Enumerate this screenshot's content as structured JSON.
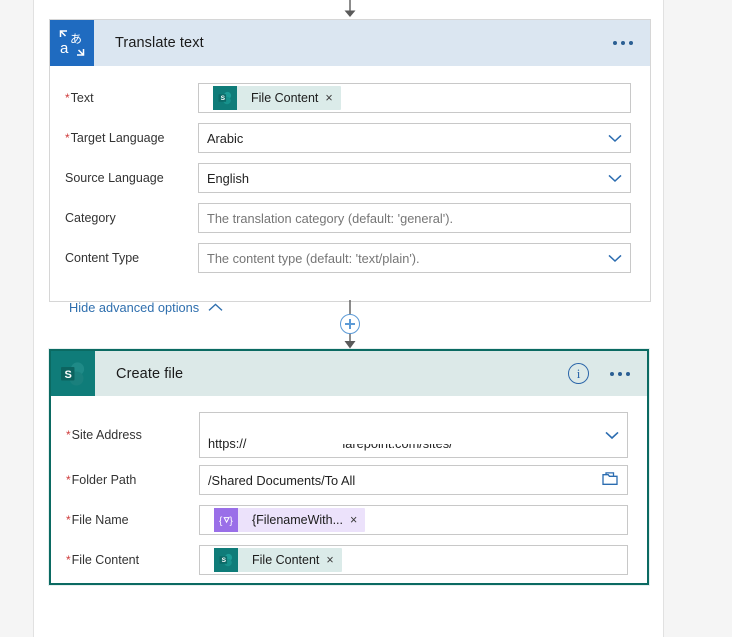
{
  "flow": {
    "actions": [
      {
        "id": "translate-text",
        "title": "Translate text",
        "icon": "translate-icon",
        "connector_color": "#1f6bc0",
        "header_color": "#dbe6f1",
        "selected": false,
        "fields": [
          {
            "label": "Text",
            "required": true,
            "type": "token",
            "token": {
              "text": "File Content",
              "icon": "sharepoint-icon",
              "style": "teal",
              "remove": "×"
            }
          },
          {
            "label": "Target Language",
            "required": true,
            "type": "dropdown",
            "value": "Arabic",
            "is_placeholder": false
          },
          {
            "label": "Source Language",
            "required": false,
            "type": "dropdown",
            "value": "English",
            "is_placeholder": false
          },
          {
            "label": "Category",
            "required": false,
            "type": "text",
            "value": "The translation category (default: 'general').",
            "is_placeholder": true
          },
          {
            "label": "Content Type",
            "required": false,
            "type": "dropdown",
            "value": "The content type (default: 'text/plain').",
            "is_placeholder": true
          }
        ],
        "advanced_options_label": "Hide advanced options",
        "advanced_options_caret": "chevron-up-icon"
      },
      {
        "id": "create-file",
        "title": "Create file",
        "icon": "sharepoint-icon",
        "connector_color": "#0f7c79",
        "header_color": "#dce9e8",
        "selected": true,
        "info_icon": "info-icon",
        "fields": [
          {
            "label": "Site Address",
            "required": true,
            "type": "dropdown",
            "value": "https://                           iarepoint.com/sites/",
            "is_placeholder": false,
            "redacted": true
          },
          {
            "label": "Folder Path",
            "required": true,
            "type": "folder",
            "value": "/Shared Documents/To All",
            "is_placeholder": false,
            "trailing_icon": "folder-icon"
          },
          {
            "label": "File Name",
            "required": true,
            "type": "token",
            "token": {
              "text": "{FilenameWith...",
              "icon": "expression-icon",
              "style": "purple",
              "remove": "×"
            }
          },
          {
            "label": "File Content",
            "required": true,
            "type": "token",
            "token": {
              "text": "File Content",
              "icon": "sharepoint-icon",
              "style": "teal",
              "remove": "×"
            }
          }
        ]
      }
    ],
    "connectors": [
      {
        "id": "arrow-top",
        "type": "arrow-down-icon"
      },
      {
        "id": "insert-step",
        "type": "plus-icon",
        "label": "+"
      },
      {
        "id": "arrow-bottom",
        "type": "arrow-down-icon"
      }
    ],
    "required_marker": "*",
    "ellipsis_label": "…",
    "info_glyph": "i"
  }
}
